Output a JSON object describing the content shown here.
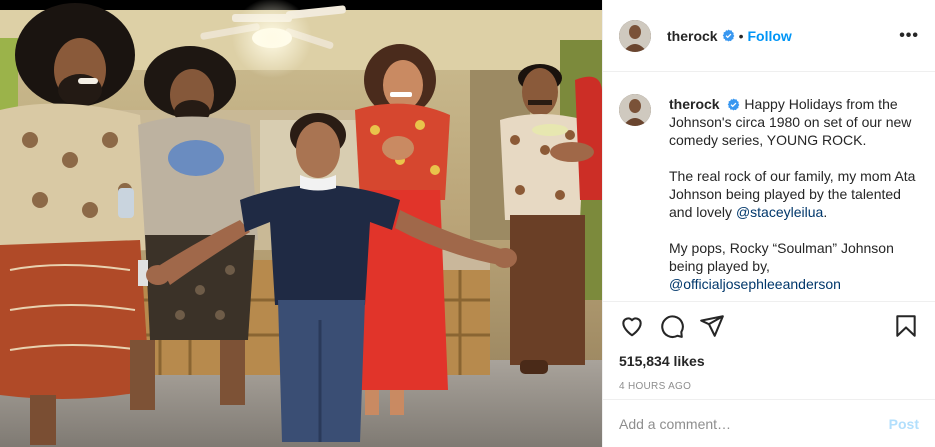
{
  "post": {
    "username": "therock",
    "follow_label": "Follow",
    "separator": "•",
    "more_label": "•••",
    "caption_user": "therock",
    "caption_paragraphs": [
      "Happy Holidays from the Johnson's circa 1980 on set of our new comedy series, YOUNG ROCK.",
      "The real rock of our family, my mom Ata Johnson being played by the talented and lovely ",
      "My pops, Rocky “Soulman” Johnson being played by, "
    ],
    "mention_1": "@staceyleilua",
    "mention_1_suffix": ".",
    "mention_2": "@officialjosephleeanderson",
    "likes": "515,834 likes",
    "time": "4 HOURS AGO",
    "comment_placeholder": "Add a comment…",
    "post_label": "Post"
  },
  "colors": {
    "link": "#0095f6",
    "mention": "#00376b",
    "post_disabled": "#b2dffc",
    "muted": "#8e8e8e",
    "text": "#262626"
  },
  "icons": [
    "verified-badge-icon",
    "heart-icon",
    "comment-icon",
    "share-icon",
    "bookmark-icon",
    "more-options-icon"
  ]
}
